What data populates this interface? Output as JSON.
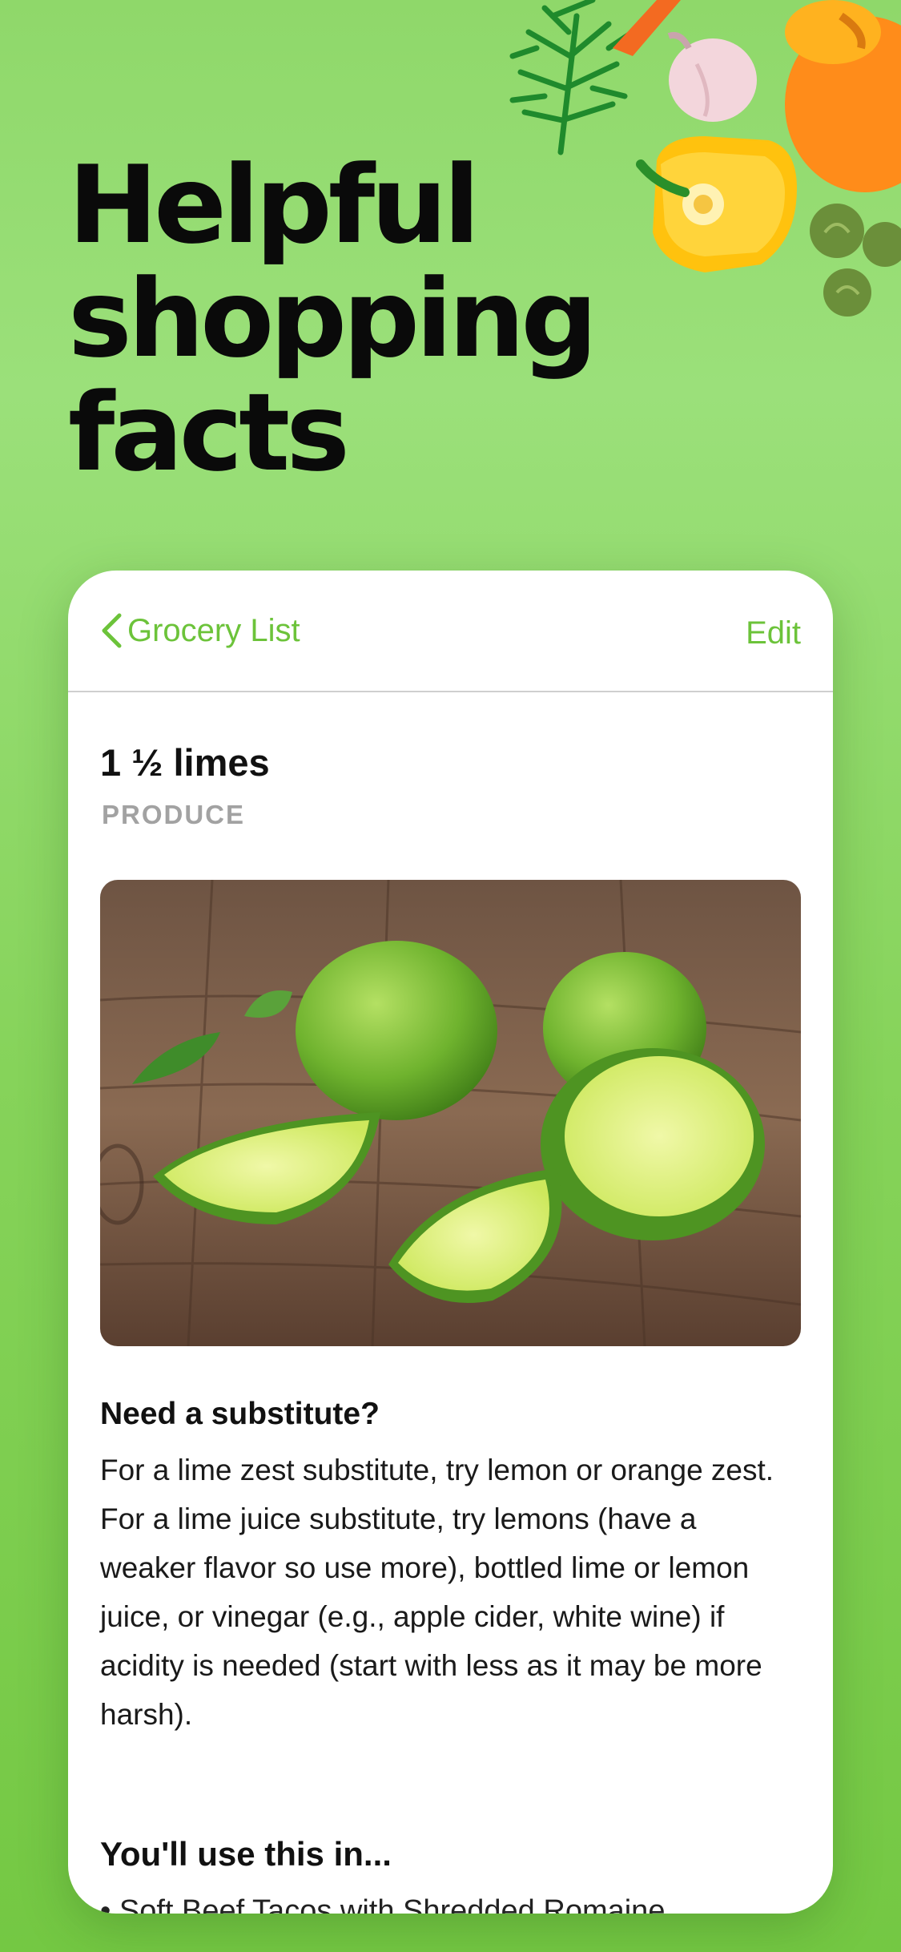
{
  "headline": {
    "lines": [
      "Helpful",
      "shopping",
      "facts"
    ]
  },
  "decor": {
    "icons": [
      "dill-icon",
      "carrot-icon",
      "garlic-icon",
      "pumpkin-icon",
      "yellow-pepper-icon",
      "brussels-sprout-icon"
    ]
  },
  "card": {
    "nav": {
      "back_icon": "chevron-left-icon",
      "back_label": "Grocery List",
      "edit_label": "Edit"
    },
    "item": {
      "title": "1 ½ limes",
      "category": "PRODUCE",
      "image": "limes-photo"
    },
    "substitute": {
      "title": "Need a substitute?",
      "body": "For a lime zest substitute, try lemon or orange zest. For a lime juice substitute, try lemons (have a weaker flavor so use more), bottled lime or lemon juice, or vinegar (e.g., apple cider, white wine) if acidity is needed (start with less as it may be more harsh)."
    },
    "usage": {
      "title": "You'll use this in...",
      "items": [
        "• Soft Beef Tacos with Shredded Romaine"
      ]
    }
  },
  "colors": {
    "accent": "#6cc33a",
    "background_top": "#9be07a",
    "background_bottom": "#74c843",
    "category_gray": "#a2a2a2"
  }
}
